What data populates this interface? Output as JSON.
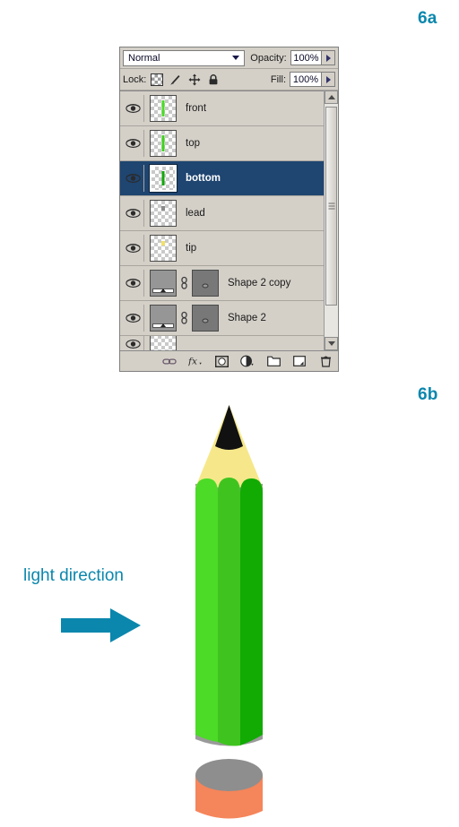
{
  "figure_labels": {
    "panel_a": "6a",
    "panel_b": "6b"
  },
  "layers_panel": {
    "blend_mode": {
      "value": "Normal",
      "icon": "chevron-down-icon"
    },
    "opacity": {
      "label": "Opacity:",
      "value": "100%",
      "stepper_icon": "chevron-right-icon"
    },
    "fill": {
      "label": "Fill:",
      "value": "100%",
      "stepper_icon": "chevron-right-icon"
    },
    "lock": {
      "label": "Lock:",
      "icons": [
        "lock-transparency-icon",
        "lock-image-pixels-brush-icon",
        "lock-position-move-icon",
        "lock-all-padlock-icon"
      ]
    },
    "layers": [
      {
        "name": "front",
        "visible": true,
        "selected": false,
        "thumb_type": "transparent-stripe",
        "thumb_color": "#4cdb27"
      },
      {
        "name": "top",
        "visible": true,
        "selected": false,
        "thumb_type": "transparent-stripe",
        "thumb_color": "#3fd11f"
      },
      {
        "name": "bottom",
        "visible": true,
        "selected": true,
        "thumb_type": "transparent-stripe",
        "thumb_color": "#13a80b"
      },
      {
        "name": "lead",
        "visible": true,
        "selected": false,
        "thumb_type": "transparent-speck",
        "thumb_color": "#8a8a8a"
      },
      {
        "name": "tip",
        "visible": true,
        "selected": false,
        "thumb_type": "transparent-speck",
        "thumb_color": "#f2e06a"
      },
      {
        "name": "Shape 2 copy",
        "visible": true,
        "selected": false,
        "thumb_type": "gradient-with-mask",
        "link_icon": "link-chain-icon"
      },
      {
        "name": "Shape 2",
        "visible": true,
        "selected": false,
        "thumb_type": "gradient-with-mask",
        "link_icon": "link-chain-icon"
      }
    ],
    "scrollbar": {
      "up_icon": "triangle-up-icon",
      "down_icon": "triangle-down-icon"
    },
    "toolbar_icons": [
      "link-layers-icon",
      "layer-style-fx-icon",
      "add-layer-mask-icon",
      "new-adjustment-layer-icon",
      "new-group-icon",
      "new-layer-icon",
      "delete-layer-trash-icon"
    ],
    "eye_icon": "eye-visibility-icon",
    "colors": {
      "panel_bg": "#d4d0c8",
      "selected_row": "#1f4571",
      "selected_text": "#ffffff"
    }
  },
  "illustration": {
    "light_direction_label": "light direction",
    "arrow_icon": "right-arrow-icon",
    "accent_color": "#0b87ad",
    "pencil": {
      "lead_color": "#111111",
      "wood_color": "#f6e88a",
      "barrel_left_color": "#4cdb27",
      "barrel_middle_color": "#3fc41f",
      "barrel_right_color": "#11ab04",
      "shadow_color": "#9a9a9a"
    },
    "eraser": {
      "top_color": "#8e8e8e",
      "body_color": "#f5855a"
    }
  }
}
